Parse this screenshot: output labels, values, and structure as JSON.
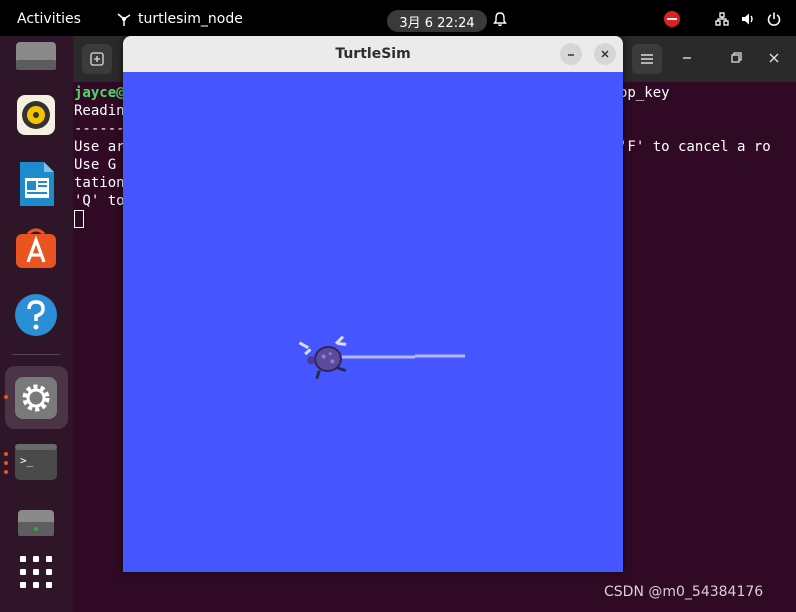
{
  "topbar": {
    "activities": "Activities",
    "app_name": "turtlesim_node",
    "clock": "3月 6  22:24"
  },
  "terminal": {
    "prompt_user": "jayce@",
    "lines_left": [
      "Readin",
      "------",
      "Use ar",
      "Use G",
      "tation",
      "'Q' to"
    ],
    "lines_right": [
      "op_key",
      "",
      "",
      "'F' to cancel a ro",
      "",
      ""
    ]
  },
  "turtlesim": {
    "title": "TurtleSim",
    "background_color": "#4556ff",
    "pen_color": "#b3b8ff"
  },
  "watermark": "CSDN @m0_54384176"
}
